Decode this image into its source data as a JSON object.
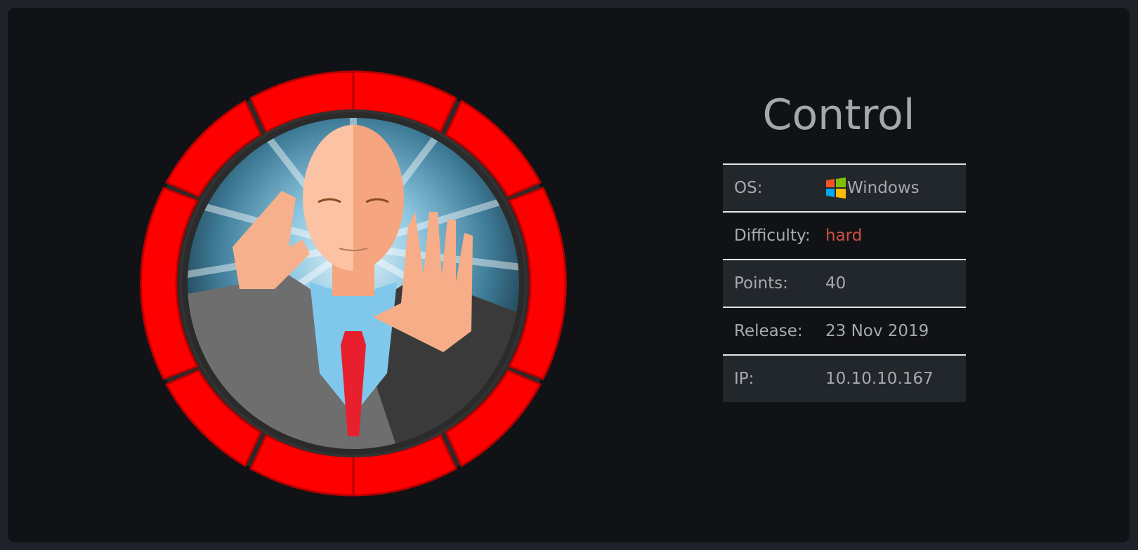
{
  "machine": {
    "name": "Control"
  },
  "info": {
    "rows": [
      {
        "label": "OS:",
        "value": "Windows",
        "icon": "windows-logo-icon"
      },
      {
        "label": "Difficulty:",
        "value": "hard"
      },
      {
        "label": "Points:",
        "value": "40"
      },
      {
        "label": "Release:",
        "value": "23 Nov 2019"
      },
      {
        "label": "IP:",
        "value": "10.10.10.167"
      }
    ]
  },
  "avatar": {
    "icon": "machine-avatar-bald-man-stop-hand",
    "ring_color": "#ff0000"
  },
  "colors": {
    "difficulty_hard": "#d04f43",
    "text": "#a6a9ae",
    "background": "#111215"
  }
}
